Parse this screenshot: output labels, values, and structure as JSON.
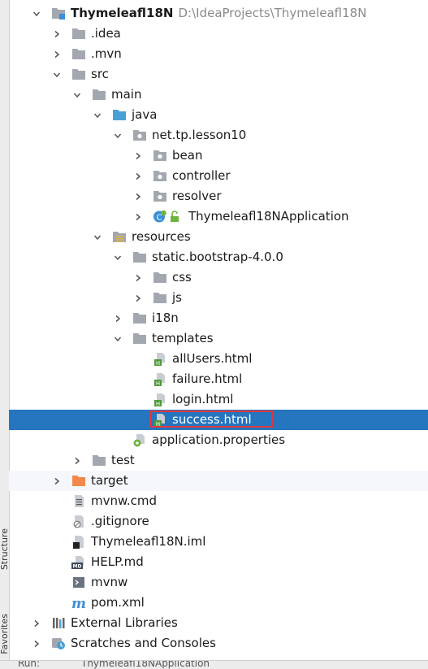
{
  "side_panel": {
    "tabs": [
      "Structure",
      "Favorites"
    ]
  },
  "tree": [
    {
      "label": "Thymeleafl18N",
      "path": "D:\\IdeaProjects\\Thymeleafl18N",
      "icon": "module-folder-icon",
      "expanded": true,
      "indent": 0,
      "bold": true
    },
    {
      "label": ".idea",
      "icon": "folder-icon",
      "expanded": false,
      "indent": 1
    },
    {
      "label": ".mvn",
      "icon": "folder-icon",
      "expanded": false,
      "indent": 1
    },
    {
      "label": "src",
      "icon": "folder-icon",
      "expanded": true,
      "indent": 1
    },
    {
      "label": "main",
      "icon": "folder-icon",
      "expanded": true,
      "indent": 2
    },
    {
      "label": "java",
      "icon": "source-folder-icon",
      "expanded": true,
      "indent": 3
    },
    {
      "label": "net.tp.lesson10",
      "icon": "package-icon",
      "expanded": true,
      "indent": 4
    },
    {
      "label": "bean",
      "icon": "package-icon",
      "expanded": false,
      "indent": 5
    },
    {
      "label": "controller",
      "icon": "package-icon",
      "expanded": false,
      "indent": 5
    },
    {
      "label": "resolver",
      "icon": "package-icon",
      "expanded": false,
      "indent": 5
    },
    {
      "label": "Thymeleafl18NApplication",
      "icon": "spring-class-icon",
      "expanded": false,
      "indent": 5,
      "extra_icon": "unlock-icon"
    },
    {
      "label": "resources",
      "icon": "resources-folder-icon",
      "expanded": true,
      "indent": 3
    },
    {
      "label": "static.bootstrap-4.0.0",
      "icon": "folder-icon",
      "expanded": true,
      "indent": 4
    },
    {
      "label": "css",
      "icon": "folder-icon",
      "expanded": false,
      "indent": 5
    },
    {
      "label": "js",
      "icon": "folder-icon",
      "expanded": false,
      "indent": 5
    },
    {
      "label": "i18n",
      "icon": "folder-icon",
      "expanded": false,
      "indent": 4
    },
    {
      "label": "templates",
      "icon": "folder-icon",
      "expanded": true,
      "indent": 4
    },
    {
      "label": "allUsers.html",
      "icon": "html-file-icon",
      "indent": 5
    },
    {
      "label": "failure.html",
      "icon": "html-file-icon",
      "indent": 5
    },
    {
      "label": "login.html",
      "icon": "html-file-icon",
      "indent": 5
    },
    {
      "label": "success.html",
      "icon": "html-file-icon",
      "indent": 5,
      "selected": true,
      "boxed": true
    },
    {
      "label": "application.properties",
      "icon": "properties-file-icon",
      "indent": 4
    },
    {
      "label": "test",
      "icon": "folder-icon",
      "expanded": false,
      "indent": 2
    },
    {
      "label": "target",
      "icon": "excluded-folder-icon",
      "expanded": false,
      "indent": 1,
      "highlighted": true
    },
    {
      "label": "mvnw.cmd",
      "icon": "text-file-icon",
      "indent": 1
    },
    {
      "label": ".gitignore",
      "icon": "ignore-file-icon",
      "indent": 1
    },
    {
      "label": "Thymeleafl18N.iml",
      "icon": "iml-file-icon",
      "indent": 1
    },
    {
      "label": "HELP.md",
      "icon": "markdown-file-icon",
      "indent": 1
    },
    {
      "label": "mvnw",
      "icon": "shell-file-icon",
      "indent": 1
    },
    {
      "label": "pom.xml",
      "icon": "maven-file-icon",
      "indent": 1
    },
    {
      "label": "External Libraries",
      "icon": "libraries-icon",
      "expanded": false,
      "indent": 0
    },
    {
      "label": "Scratches and Consoles",
      "icon": "scratches-icon",
      "expanded": false,
      "indent": 0
    }
  ],
  "bottom_bar": {
    "run_label": "Run:",
    "config_label": "Thymeleafl18NApplication"
  },
  "colors": {
    "selection": "#2675bf",
    "highlight_box": "#e0393e",
    "folder": "#a3a8b0",
    "source_folder": "#4a9fd6",
    "excluded_folder": "#f2884b"
  }
}
